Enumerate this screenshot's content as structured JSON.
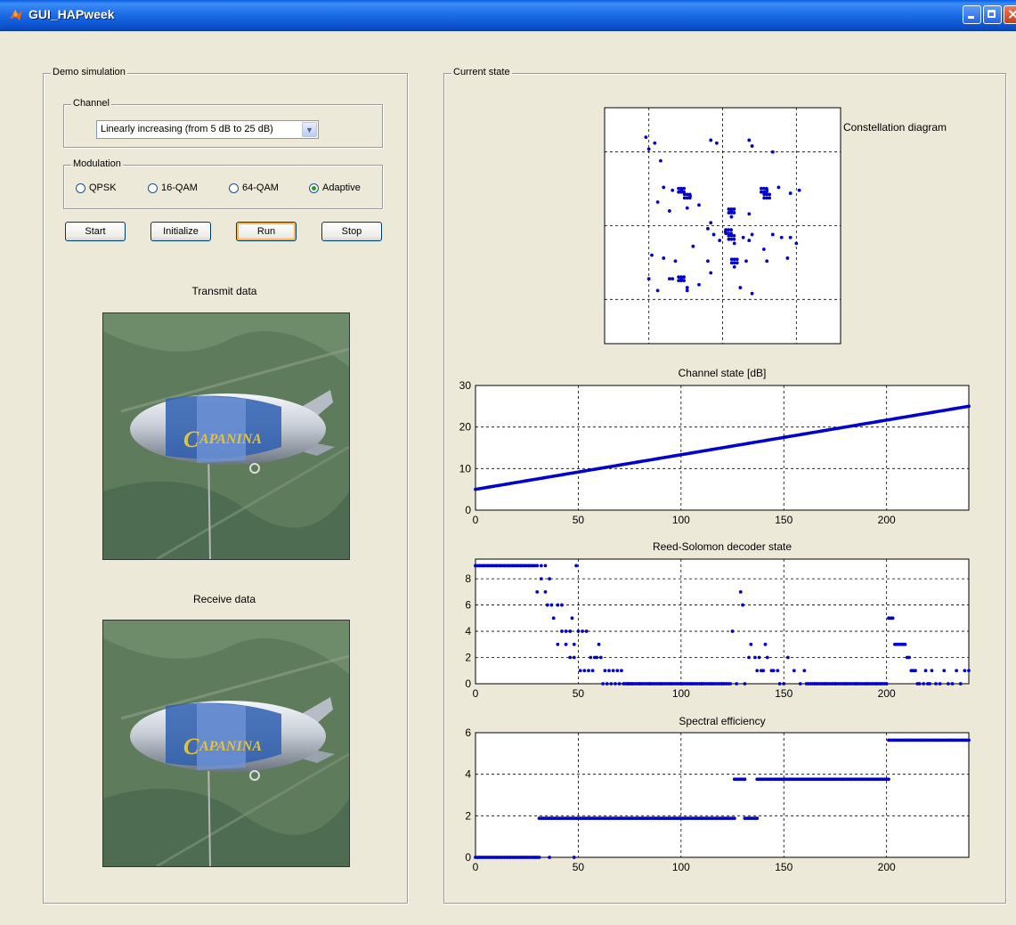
{
  "window": {
    "title": "GUI_HAPweek",
    "controls": [
      "minimize-icon",
      "maximize-icon",
      "close-icon"
    ]
  },
  "demo_panel": {
    "title": "Demo simulation",
    "channel": {
      "title": "Channel",
      "selected": "Linearly increasing (from 5 dB to 25 dB)"
    },
    "modulation": {
      "title": "Modulation",
      "options": [
        {
          "label": "QPSK",
          "selected": false
        },
        {
          "label": "16-QAM",
          "selected": false
        },
        {
          "label": "64-QAM",
          "selected": false
        },
        {
          "label": "Adaptive",
          "selected": true
        }
      ]
    },
    "buttons": {
      "start": "Start",
      "initialize": "Initialize",
      "run": "Run",
      "stop": "Stop"
    },
    "transmit_label": "Transmit data",
    "receive_label": "Receive data",
    "image_text": "CAPANINA"
  },
  "state_panel": {
    "title": "Current state",
    "constellation_label": "Constellation diagram",
    "channel_title": "Channel state [dB]",
    "rs_title": "Reed-Solomon decoder state",
    "se_title": "Spectral efficiency"
  },
  "colors": {
    "marker": "#0000C8",
    "background": "#ECE9D8",
    "titlebar": "#0B53D0"
  },
  "chart_data": [
    {
      "type": "scatter",
      "title": "Constellation diagram",
      "xlim": [
        -4,
        4
      ],
      "ylim": [
        -4,
        4
      ],
      "grid": true,
      "ticks_shown": false,
      "x": [
        -2.6,
        -2.3,
        -2.5,
        -2.1,
        -2.0,
        -1.7,
        -2.2,
        -1.8,
        -0.4,
        -0.2,
        0.9,
        1.0,
        1.7,
        -1.4,
        -1.1,
        -1.2,
        -0.8,
        0.3,
        0.9,
        1.5,
        1.9,
        2.3,
        2.6,
        -0.4,
        -0.5,
        0.1,
        0.3,
        0.9,
        1.0,
        1.7,
        2.0,
        -1.0,
        -0.3,
        -0.1,
        0.7,
        0.4,
        1.4,
        2.3,
        2.5,
        -2.4,
        -2.0,
        -1.6,
        -1.8,
        -1.4,
        -1.2,
        -0.5,
        -0.4,
        0.4,
        0.8,
        1.5,
        2.2,
        -2.5,
        -2.2,
        -1.7,
        -1.2,
        -0.8,
        0.6,
        1.0
      ],
      "y": [
        3.0,
        2.8,
        2.6,
        2.2,
        1.3,
        1.2,
        0.8,
        0.5,
        2.9,
        2.8,
        2.9,
        2.7,
        2.5,
        1.2,
        1.0,
        0.6,
        0.7,
        0.5,
        0.4,
        1.2,
        1.3,
        1.1,
        1.2,
        0.1,
        -0.1,
        -0.2,
        0.3,
        -0.5,
        -0.3,
        -0.3,
        -0.4,
        -0.7,
        -0.3,
        -0.5,
        -0.4,
        -0.6,
        -0.8,
        -0.4,
        -0.6,
        -1.0,
        -1.1,
        -1.2,
        -1.8,
        -1.8,
        -2.1,
        -1.2,
        -1.6,
        -1.4,
        -1.2,
        -1.2,
        -1.1,
        -1.8,
        -2.2,
        -1.8,
        -2.2,
        -2.0,
        -2.1,
        -2.3
      ]
    },
    {
      "type": "scatter",
      "title": "Channel state [dB]",
      "xlim": [
        0,
        240
      ],
      "ylim": [
        0,
        30
      ],
      "xticks": [
        0,
        50,
        100,
        150,
        200
      ],
      "yticks": [
        0,
        10,
        20,
        30
      ],
      "grid": true,
      "points_from": [
        0,
        5
      ],
      "points_to": [
        240,
        25
      ],
      "n_points": 240
    },
    {
      "type": "scatter",
      "title": "Reed-Solomon decoder state",
      "xlim": [
        0,
        240
      ],
      "ylim": [
        0,
        9.5
      ],
      "xticks": [
        0,
        50,
        100,
        150,
        200
      ],
      "yticks": [
        0,
        2,
        4,
        6,
        8
      ],
      "grid": true,
      "x": [
        0,
        2,
        4,
        6,
        8,
        10,
        12,
        14,
        16,
        18,
        20,
        22,
        24,
        26,
        28,
        30,
        32,
        34,
        36,
        30,
        32,
        34,
        35,
        37,
        38,
        40,
        42,
        44,
        40,
        42,
        44,
        46,
        47,
        48,
        46,
        48,
        50,
        52,
        54,
        56,
        58,
        60,
        49,
        51,
        53,
        55,
        57,
        59,
        61,
        63,
        65,
        67,
        69,
        71,
        62,
        64,
        66,
        68,
        70,
        72,
        74,
        76,
        80,
        85,
        90,
        95,
        100,
        105,
        110,
        115,
        120,
        124,
        125,
        127,
        129,
        130,
        131,
        133,
        134,
        136,
        137,
        138,
        139,
        140,
        141,
        142,
        144,
        145,
        147,
        148,
        150,
        152,
        155,
        158,
        160,
        165,
        170,
        175,
        180,
        185,
        190,
        195,
        200,
        201,
        202,
        203,
        204,
        205,
        206,
        207,
        208,
        209,
        210,
        211,
        212,
        213,
        214,
        215,
        216,
        218,
        219,
        220,
        221,
        222,
        224,
        226,
        228,
        230,
        232,
        234,
        236,
        238,
        240
      ],
      "y": [
        9,
        9,
        9,
        9,
        9,
        9,
        9,
        9,
        9,
        9,
        9,
        9,
        9,
        9,
        9,
        9,
        9,
        9,
        8,
        7,
        8,
        7,
        6,
        6,
        5,
        6,
        6,
        4,
        3,
        4,
        3,
        4,
        5,
        3,
        2,
        2,
        4,
        4,
        4,
        2,
        2,
        3,
        9,
        1,
        1,
        1,
        1,
        2,
        2,
        1,
        1,
        1,
        1,
        1,
        0,
        0,
        0,
        0,
        0,
        0,
        0,
        0,
        0,
        0,
        0,
        0,
        0,
        0,
        0,
        0,
        0,
        0,
        4,
        0,
        7,
        6,
        0,
        2,
        3,
        2,
        1,
        2,
        1,
        1,
        3,
        2,
        1,
        1,
        1,
        0,
        0,
        2,
        1,
        0,
        1,
        0,
        0,
        0,
        0,
        0,
        0,
        0,
        0,
        5,
        5,
        5,
        3,
        3,
        3,
        3,
        3,
        3,
        2,
        2,
        1,
        1,
        1,
        0,
        0,
        0,
        1,
        0,
        0,
        1,
        0,
        0,
        1,
        0,
        0,
        1,
        0,
        1,
        1
      ]
    },
    {
      "type": "scatter",
      "title": "Spectral efficiency",
      "xlim": [
        0,
        240
      ],
      "ylim": [
        0,
        6
      ],
      "xticks": [
        0,
        50,
        100,
        150,
        200
      ],
      "yticks": [
        0,
        2,
        4,
        6
      ],
      "grid": true,
      "segments": [
        {
          "x_from": 0,
          "x_to": 31,
          "y": 0
        },
        {
          "x_from": 31,
          "x_to": 126,
          "y": 1.88
        },
        {
          "x_from": 126,
          "x_to": 131,
          "y": 3.76
        },
        {
          "x_from": 131,
          "x_to": 137,
          "y": 1.88
        },
        {
          "x_from": 137,
          "x_to": 201,
          "y": 3.76
        },
        {
          "x_from": 201,
          "x_to": 240,
          "y": 5.64
        }
      ],
      "extra_points": [
        [
          36,
          0
        ],
        [
          48,
          0
        ]
      ]
    }
  ]
}
